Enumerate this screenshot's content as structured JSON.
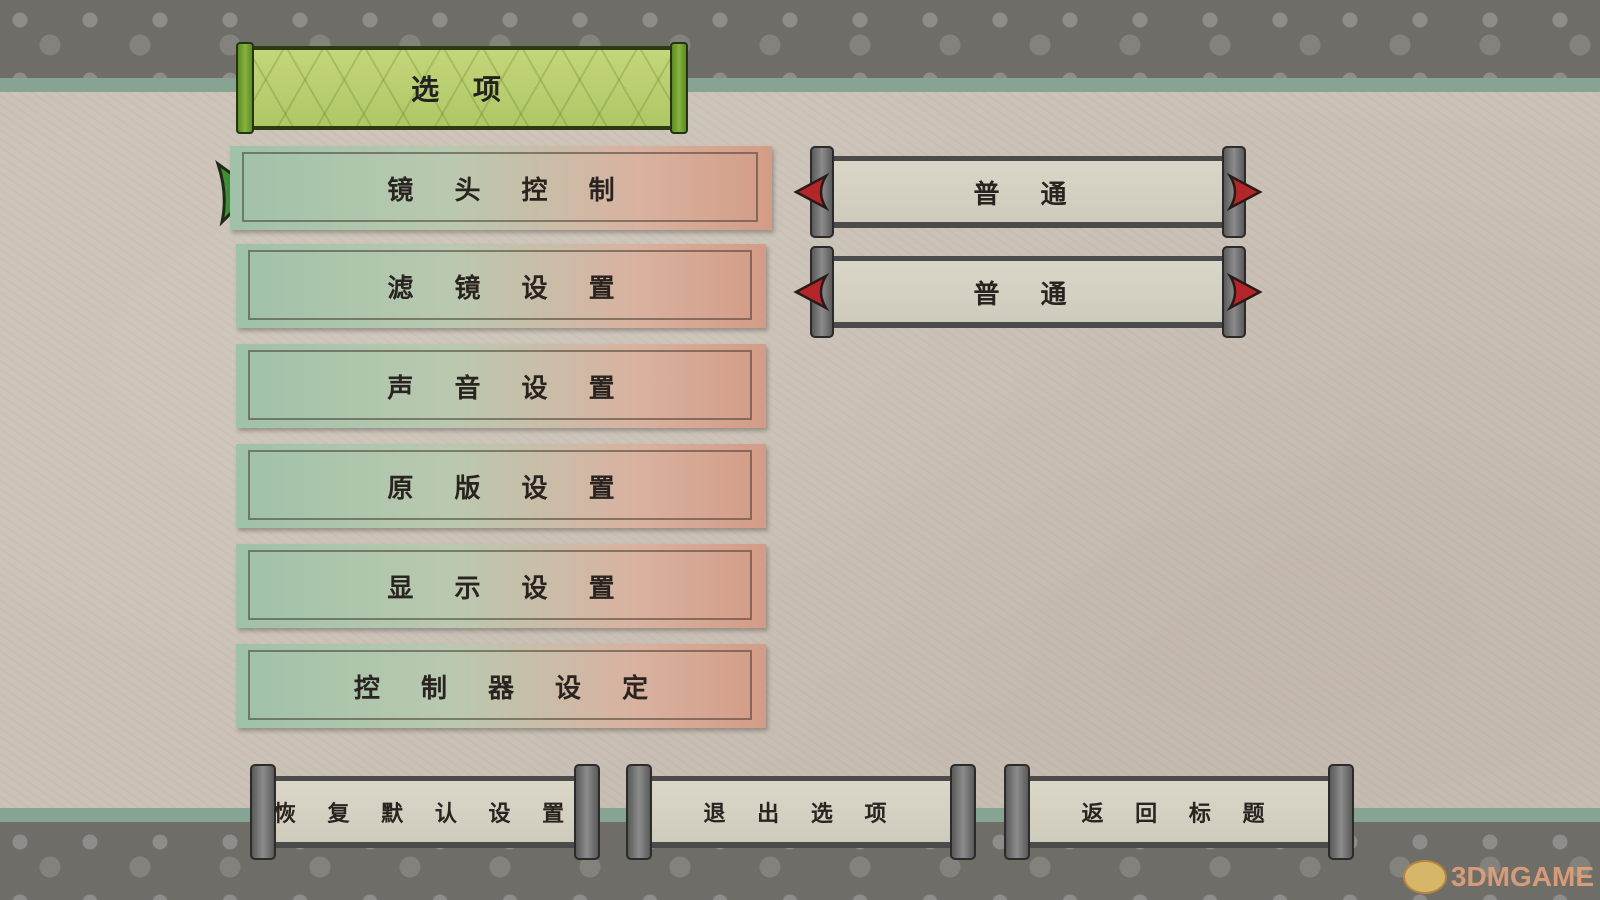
{
  "title": "选 项",
  "menu": [
    {
      "label": "镜 头 控 制",
      "selected": true
    },
    {
      "label": "滤 镜 设 置",
      "selected": false
    },
    {
      "label": "声 音 设 置",
      "selected": false
    },
    {
      "label": "原 版 设 置",
      "selected": false
    },
    {
      "label": "显 示 设 置",
      "selected": false
    },
    {
      "label": "控 制 器 设 定",
      "selected": false
    }
  ],
  "values": [
    {
      "label": "普 通"
    },
    {
      "label": "普 通"
    }
  ],
  "bottom_buttons": [
    {
      "label": "恢 复 默 认 设 置"
    },
    {
      "label": "退 出 选 项"
    },
    {
      "label": "返 回 标 题"
    }
  ],
  "watermark": "3DMGAME",
  "colors": {
    "title_green": "#b8cd6e",
    "cursor_green": "#3e8f36",
    "arrow_red": "#b5262a",
    "stripe": "#86a394"
  }
}
